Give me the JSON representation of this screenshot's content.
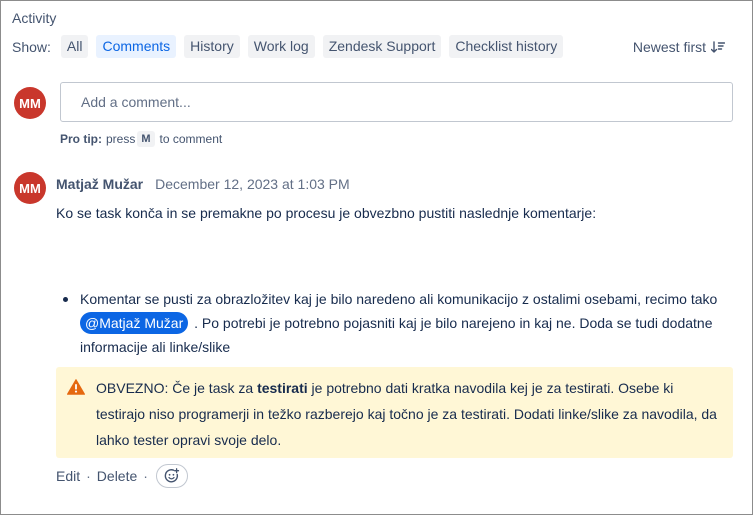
{
  "activity": {
    "title": "Activity",
    "show_label": "Show:",
    "filters": [
      {
        "label": "All",
        "active": false
      },
      {
        "label": "Comments",
        "active": true
      },
      {
        "label": "History",
        "active": false
      },
      {
        "label": "Work log",
        "active": false
      },
      {
        "label": "Zendesk Support",
        "active": false
      },
      {
        "label": "Checklist history",
        "active": false
      }
    ],
    "sort_label": "Newest first",
    "sort_icon": "sort-descending-icon"
  },
  "composer": {
    "avatar_initials": "MM",
    "avatar_color": "#c9372c",
    "placeholder": "Add a comment...",
    "pro_tip_label": "Pro tip:",
    "pro_tip_press": "press",
    "pro_tip_key": "M",
    "pro_tip_suffix": "to comment"
  },
  "comment": {
    "avatar_initials": "MM",
    "author": "Matjaž Mužar",
    "timestamp": "December 12, 2023 at 1:03 PM",
    "intro": "Ko se task konča in se premakne po procesu je obvezbno pustiti naslednje komentarje:",
    "bullet": {
      "before": "Komentar se pusti za obrazložitev kaj je bilo naredeno ali komunikacijo z ostalimi osebami, recimo tako",
      "mention": "@Matjaž Mužar",
      "after": ". Po potrebi je potrebno pojasniti kaj je bilo narejeno in kaj ne. Doda se tudi dodatne informacije ali linke/slike"
    },
    "warning": {
      "icon": "warning-icon",
      "prefix": "OBVEZNO: Če je task za ",
      "bold": "testirati",
      "suffix": " je potrebno dati kratka navodila kej je za testirati. Osebe ki testirajo niso programerji in težko razberejo kaj točno je za testirati. Dodati linke/slike za navodila, da lahko tester opravi svoje delo."
    },
    "actions": {
      "edit": "Edit",
      "separator": "·",
      "delete": "Delete",
      "reaction_icon": "add-reaction-icon"
    }
  },
  "colors": {
    "accent": "#0c66e4",
    "warning_bg": "#fff7d6",
    "warning_icon": "#e56910"
  }
}
